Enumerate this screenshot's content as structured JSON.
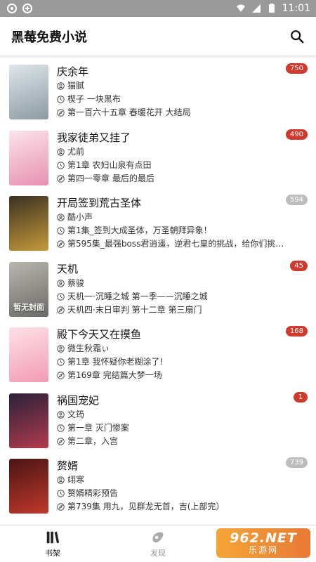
{
  "status_bar": {
    "time": "11:01"
  },
  "app_bar": {
    "title": "黑莓免费小说"
  },
  "books": [
    {
      "title": "庆余年",
      "author": "猫腻",
      "latest_read": "楔子 一块黑布",
      "latest_chapter": "第一百六十五章 春暖花开 大结局",
      "badge": "750",
      "badge_style": "red",
      "cover_text": "",
      "cover_colors": [
        "#dfe6ea",
        "#8c9aa3"
      ]
    },
    {
      "title": "我家徒弟又挂了",
      "author": "尤前",
      "latest_read": "第1章 农妇山泉有点田",
      "latest_chapter": "第四一零章 最后的最后",
      "badge": "490",
      "badge_style": "red",
      "cover_text": "",
      "cover_colors": [
        "#fbe3ea",
        "#e890b0"
      ]
    },
    {
      "title": "开局签到荒古圣体",
      "author": "酷小声",
      "latest_read": "第1集_签到大成圣体，万圣朝拜异象！",
      "latest_chapter": "第595集_最强boss君逍遥，逆君七皇的挑战，给你们挑…",
      "badge": "594",
      "badge_style": "grey",
      "cover_text": "",
      "cover_colors": [
        "#3a3022",
        "#c69a3a"
      ]
    },
    {
      "title": "天机",
      "author": "蔡骏",
      "latest_read": "天机一·沉睡之城 第一季——沉睡之城",
      "latest_chapter": "天机四·末日审判 第十二章 第三扇门",
      "badge": "45",
      "badge_style": "red",
      "cover_text": "暂无封面",
      "cover_colors": [
        "#b9b6b0",
        "#6b6a66"
      ]
    },
    {
      "title": "殿下今天又在摸鱼",
      "author": "微生秋霜ぃ",
      "latest_read": "第1章 我怀疑你老糊涂了!",
      "latest_chapter": "第169章 完结篇大梦一场",
      "badge": "168",
      "badge_style": "red",
      "cover_text": "",
      "cover_colors": [
        "#fde1e8",
        "#f29bb3"
      ]
    },
    {
      "title": "祸国宠妃",
      "author": "文筠",
      "latest_read": "第一章 灭门惨案",
      "latest_chapter": "第二章，入宫",
      "badge": "1",
      "badge_style": "red",
      "cover_text": "",
      "cover_colors": [
        "#2a2138",
        "#b23a4e"
      ]
    },
    {
      "title": "赘婿",
      "author": "翊寒",
      "latest_read": "赘婿精彩预告",
      "latest_chapter": "第739集 用九，见群龙无首，吉(上部完）",
      "badge": "739",
      "badge_style": "grey",
      "cover_text": "",
      "cover_colors": [
        "#4a1414",
        "#c0392b"
      ]
    }
  ],
  "tabs": [
    {
      "label": "书架",
      "icon": "bookshelf-icon",
      "active": true
    },
    {
      "label": "发现",
      "icon": "discover-icon",
      "active": false
    }
  ],
  "watermark": {
    "line1": "962.NET",
    "line2": "乐游网"
  },
  "colors": {
    "badge_red": "#d0392c",
    "badge_grey": "#bdbdbd",
    "status_bar": "#9a9a9a",
    "watermark": "#f0902c"
  }
}
